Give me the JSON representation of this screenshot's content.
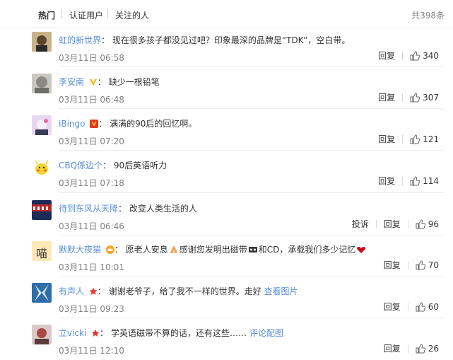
{
  "tabs": {
    "hot": "热门",
    "verified": "认证用户",
    "following": "关注的人"
  },
  "total": "共398条",
  "actions": {
    "reply": "回复",
    "report": "投诉"
  },
  "comments": [
    {
      "user": "虹的新世界",
      "sep": "：",
      "text": "现在很多孩子都没见过吧？印象最深的品牌是“TDK”，空白带。",
      "time": "03月11日 06:58",
      "likes": "340",
      "avatar_color": "#9a8a6a"
    },
    {
      "user": "李安南",
      "sep": "：",
      "text": "缺少一根铅笔",
      "time": "03月11日 06:48",
      "likes": "307",
      "avatar_color": "#b8b8b0"
    },
    {
      "user": "iBingo",
      "sep": "：",
      "text": "满满的90后的回忆啊。",
      "time": "03月11日 07:20",
      "likes": "121",
      "avatar_color": "#d9c2e6"
    },
    {
      "user": "CBQ係边个",
      "sep": "：",
      "text": "90后英语听力",
      "time": "03月11日 07:18",
      "likes": "114",
      "avatar_color": "#f3e28a"
    },
    {
      "user": "待到东风从天降",
      "sep": "：",
      "text": "改变人类生活的人",
      "time": "03月11日 06:46",
      "likes": "96",
      "avatar_color": "#8a2b2b"
    },
    {
      "user": "默默大夜猫",
      "sep": "：",
      "text_a": "愿老人安息",
      "text_b": "感谢您发明出磁带",
      "text_c": "和CD，承载我们多少记忆",
      "time": "03月11日 10:01",
      "likes": "70",
      "avatar_color": "#fde9b8",
      "avatar_text": "喵"
    },
    {
      "user": "有声人",
      "sep": "：",
      "text": "谢谢老爷子，给了我不一样的世界。走好",
      "link": "查看图片",
      "time": "03月11日 09:23",
      "likes": "60",
      "avatar_color": "#2f6da8"
    },
    {
      "user": "立vicki",
      "sep": "：",
      "text": "学英语磁带不算的话，还有这些……",
      "link": "评论配图",
      "time": "03月11日 12:10",
      "likes": "26",
      "avatar_color": "#a84a4a"
    }
  ]
}
